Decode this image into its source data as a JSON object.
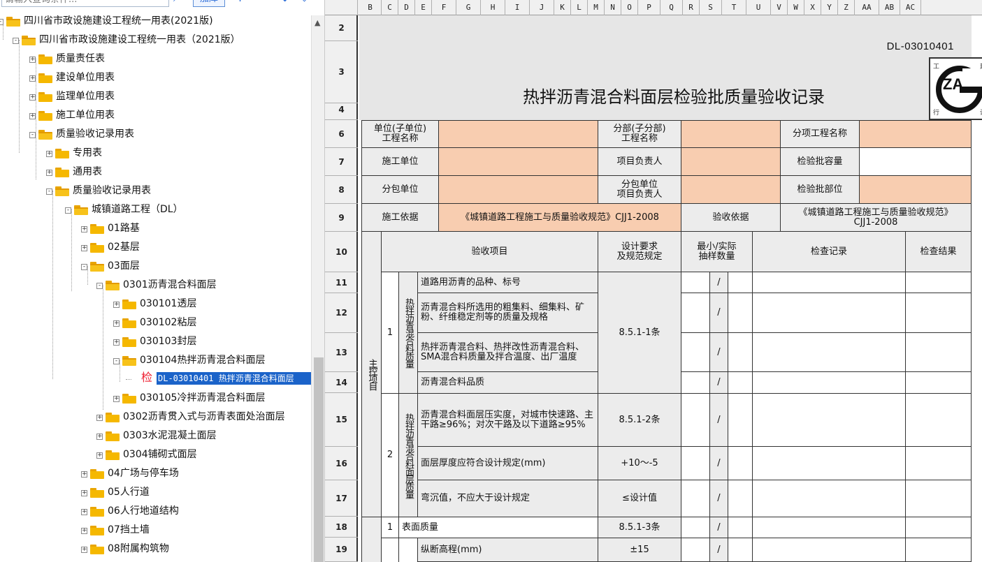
{
  "toolbar": {
    "search_placeholder": "请输入查询条件...",
    "add_button": "加库",
    "icons": [
      "search-icon",
      "plus-icon",
      "minus-icon",
      "arrow-down-icon",
      "arrow-down-circle-icon"
    ]
  },
  "tree": {
    "items": [
      {
        "label": "四川省市政设施建设工程统一用表(2021版)"
      },
      {
        "label": "四川省市政设施建设工程统一用表（2021版）"
      },
      {
        "label": "质量责任表"
      },
      {
        "label": "建设单位用表"
      },
      {
        "label": "监理单位用表"
      },
      {
        "label": "施工单位用表"
      },
      {
        "label": "质量验收记录用表"
      },
      {
        "label": "专用表"
      },
      {
        "label": "通用表"
      },
      {
        "label": "质量验收记录用表"
      },
      {
        "label": "城镇道路工程（DL）"
      },
      {
        "label": "01路基"
      },
      {
        "label": "02基层"
      },
      {
        "label": "03面层"
      },
      {
        "label": "0301沥青混合料面层"
      },
      {
        "label": "030101透层"
      },
      {
        "label": "030102粘层"
      },
      {
        "label": "030103封层"
      },
      {
        "label": "030104热拌沥青混合料面层"
      },
      {
        "label": "DL-03010401 热拌沥青混合料面层",
        "prefix": "检"
      },
      {
        "label": "030105冷拌沥青混合料面层"
      },
      {
        "label": "0302沥青贯入式与沥青表面处治面层"
      },
      {
        "label": "0303水泥混凝土面层"
      },
      {
        "label": "0304铺砌式面层"
      },
      {
        "label": "04广场与停车场"
      },
      {
        "label": "05人行道"
      },
      {
        "label": "06人行地道结构"
      },
      {
        "label": "07挡土墙"
      },
      {
        "label": "08附属构筑物"
      }
    ]
  },
  "sheet": {
    "columns": [
      "B",
      "C",
      "D",
      "E",
      "F",
      "G",
      "H",
      "I",
      "J",
      "K",
      "L",
      "M",
      "N",
      "O",
      "P",
      "Q",
      "R",
      "S",
      "T",
      "U",
      "V",
      "W",
      "X",
      "Y",
      "Z",
      "AA",
      "AB",
      "AC"
    ],
    "rows": [
      "2",
      "3",
      "4",
      "6",
      "7",
      "8",
      "9",
      "10",
      "11",
      "12",
      "13",
      "14",
      "15",
      "16",
      "17",
      "18",
      "19"
    ],
    "doc_code": "DL-03010401",
    "title": "热拌沥青混合料面层检验批质量验收记录",
    "logo": {
      "main": "ZA",
      "corners": [
        "工",
        "建",
        "行",
        "设"
      ]
    },
    "info": {
      "unit_name_label": "单位(子单位)\n工程名称",
      "division_label": "分部(子分部)\n工程名称",
      "item_name_label": "分项工程名称",
      "builder_label": "施工单位",
      "pm_label": "项目负责人",
      "capacity_label": "检验批容量",
      "sub_label": "分包单位",
      "sub_pm_label": "分包单位\n项目负责人",
      "part_label": "检验批部位",
      "basis_label": "施工依据",
      "basis_value": "《城镇道路工程施工与质量验收规范》CJJ1-2008",
      "accept_label": "验收依据",
      "accept_value": "《城镇道路工程施工与质量验收规范》\nCJJ1-2008"
    },
    "header": {
      "item": "验收项目",
      "design": "设计要求\n及规范规定",
      "sample": "最小/实际\n抽样数量",
      "record": "检查记录",
      "result": "检查结果"
    },
    "main_control": "主控项目",
    "group1_no": "1",
    "group1_label": "热拌沥青混合料质量",
    "group2_no": "2",
    "group2_label": "热拌沥青混合料面层质量",
    "items": [
      {
        "text": "道路用沥青的品种、标号"
      },
      {
        "text": "沥青混合料所选用的粗集料、细集料、矿粉、纤维稳定剂等的质量及规格"
      },
      {
        "text": "热拌沥青混合料、热拌改性沥青混合料、SMA混合料质量及拌合温度、出厂温度"
      },
      {
        "text": "沥青混合料品质"
      },
      {
        "text": "沥青混合料面层压实度，对城市快速路、主干路≥96%；对次干路及以下道路≥95%",
        "spec": "8.5.1-2条"
      },
      {
        "text": "面层厚度应符合设计规定(mm)",
        "spec": "+10～-5"
      },
      {
        "text": "弯沉值，不应大于设计规定",
        "spec": "≤设计值"
      }
    ],
    "group1_spec": "8.5.1-1条",
    "general_no": "1",
    "surface_label": "表面质量",
    "surface_spec": "8.5.1-3条",
    "elev_label": "纵断高程(mm)",
    "elev_spec": "±15",
    "slash": "/"
  }
}
